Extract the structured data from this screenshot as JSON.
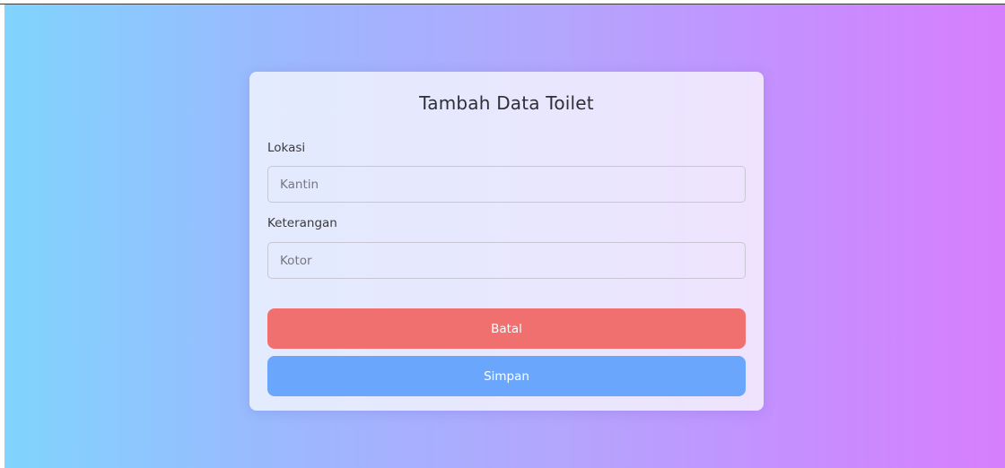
{
  "form": {
    "title": "Tambah Data Toilet",
    "lokasi": {
      "label": "Lokasi",
      "placeholder": "Kantin",
      "value": ""
    },
    "keterangan": {
      "label": "Keterangan",
      "placeholder": "Kotor",
      "value": ""
    },
    "buttons": {
      "cancel_label": "Batal",
      "save_label": "Simpan"
    }
  },
  "colors": {
    "background_gradient_start": "#80d4fd",
    "background_gradient_end": "#d77efd",
    "cancel_button": "#ef706f",
    "save_button": "#6ba6fd"
  }
}
